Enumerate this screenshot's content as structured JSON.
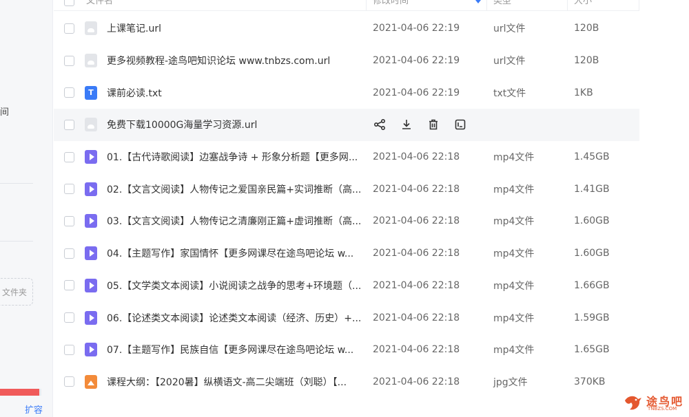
{
  "sidebar": {
    "partial_text": "间",
    "new_folder_label": "文件夹",
    "expand_label": "扩容",
    "quota_used_fraction": 0.95
  },
  "header": {
    "col_name": "文件名",
    "col_time": "修改时间",
    "col_type": "类型",
    "col_size": "大小"
  },
  "rows": [
    {
      "name": "上课笔记.url",
      "time": "2021-04-06 22:19",
      "type": "url文件",
      "size": "120B",
      "icon": "url-file-icon"
    },
    {
      "name": "更多视频教程-途鸟吧知识论坛 www.tnbzs.com.url",
      "time": "2021-04-06 22:19",
      "type": "url文件",
      "size": "120B",
      "icon": "url-file-icon"
    },
    {
      "name": "课前必读.txt",
      "time": "2021-04-06 22:19",
      "type": "txt文件",
      "size": "1KB",
      "icon": "txt-file-icon"
    },
    {
      "name": "免费下载10000G海量学习资源.url",
      "time": "",
      "type": "",
      "size": "",
      "icon": "url-file-icon"
    },
    {
      "name": "01.【古代诗歌阅读】边塞战争诗 + 形象分析题【更多网...",
      "time": "2021-04-06 22:18",
      "type": "mp4文件",
      "size": "1.45GB",
      "icon": "video-file-icon"
    },
    {
      "name": "02.【文言文阅读】人物传记之爱国亲民篇+实词推断（高...",
      "time": "2021-04-06 22:18",
      "type": "mp4文件",
      "size": "1.41GB",
      "icon": "video-file-icon"
    },
    {
      "name": "03.【文言文阅读】人物传记之清廉刚正篇+虚词推断（高...",
      "time": "2021-04-06 22:18",
      "type": "mp4文件",
      "size": "1.60GB",
      "icon": "video-file-icon"
    },
    {
      "name": "04.【主题写作】家国情怀【更多网课尽在途鸟吧论坛 w...",
      "time": "2021-04-06 22:18",
      "type": "mp4文件",
      "size": "1.60GB",
      "icon": "video-file-icon"
    },
    {
      "name": "05.【文学类文本阅读】小说阅读之战争的思考+环境题（...",
      "time": "2021-04-06 22:18",
      "type": "mp4文件",
      "size": "1.66GB",
      "icon": "video-file-icon"
    },
    {
      "name": "06.【论述类文本阅读】论述类文本阅读（经济、历史）+...",
      "time": "2021-04-06 22:18",
      "type": "mp4文件",
      "size": "1.59GB",
      "icon": "video-file-icon"
    },
    {
      "name": "07.【主题写作】民族自信【更多网课尽在途鸟吧论坛 w...",
      "time": "2021-04-06 22:18",
      "type": "mp4文件",
      "size": "1.65GB",
      "icon": "video-file-icon"
    },
    {
      "name": "课程大纲：【2020暑】纵横语文-高二尖端班（刘聪）【...",
      "time": "2021-04-06 22:18",
      "type": "jpg文件",
      "size": "370KB",
      "icon": "image-file-icon"
    }
  ],
  "txt_icon_letter": "T",
  "hover_actions": [
    "share-icon",
    "download-icon",
    "delete-icon",
    "more-icon"
  ],
  "watermark": {
    "text": "途鸟吧",
    "sub": "TNBZS.COM"
  },
  "colors": {
    "accent": "#3a7bf7",
    "video_icon": "#7a6cf0",
    "image_icon": "#f38b3a",
    "quota_bar": "#f05b5b",
    "watermark": "#e4572e"
  }
}
